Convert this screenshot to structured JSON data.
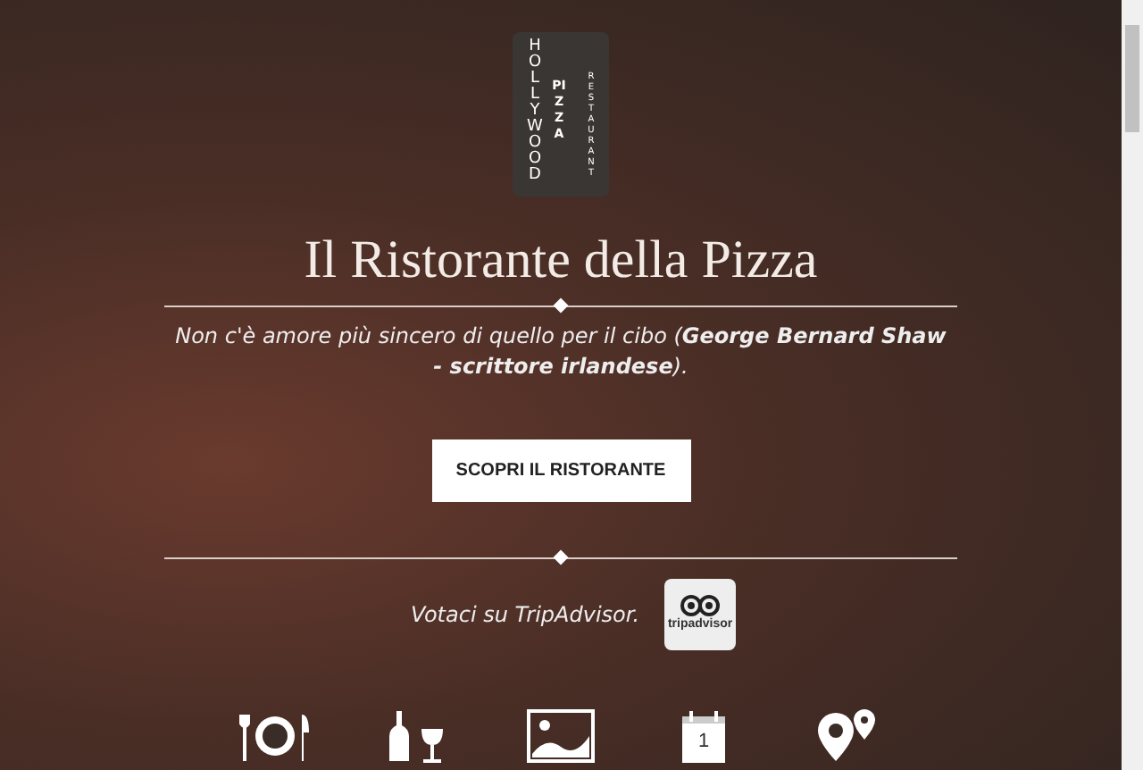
{
  "logo": {
    "word_1": "HOLLYWOOD",
    "word_2": "PIZZA",
    "word_3": "RESTAURANT"
  },
  "title": "Il Ristorante della Pizza",
  "quote": "Non c'è amore più sincero di quello per il cibo (**George Bernard Shaw - scrittore irlandese**).",
  "button": "SCOPRI IL RISTORANTE",
  "tripadvisor": {
    "text": "Votaci su TripAdvisor.",
    "badge": "tripadvisor"
  },
  "nav_icons": [
    {
      "kind": "dining"
    },
    {
      "kind": "wine"
    },
    {
      "kind": "gallery"
    },
    {
      "kind": "calendar",
      "day": "1"
    },
    {
      "kind": "map"
    }
  ]
}
